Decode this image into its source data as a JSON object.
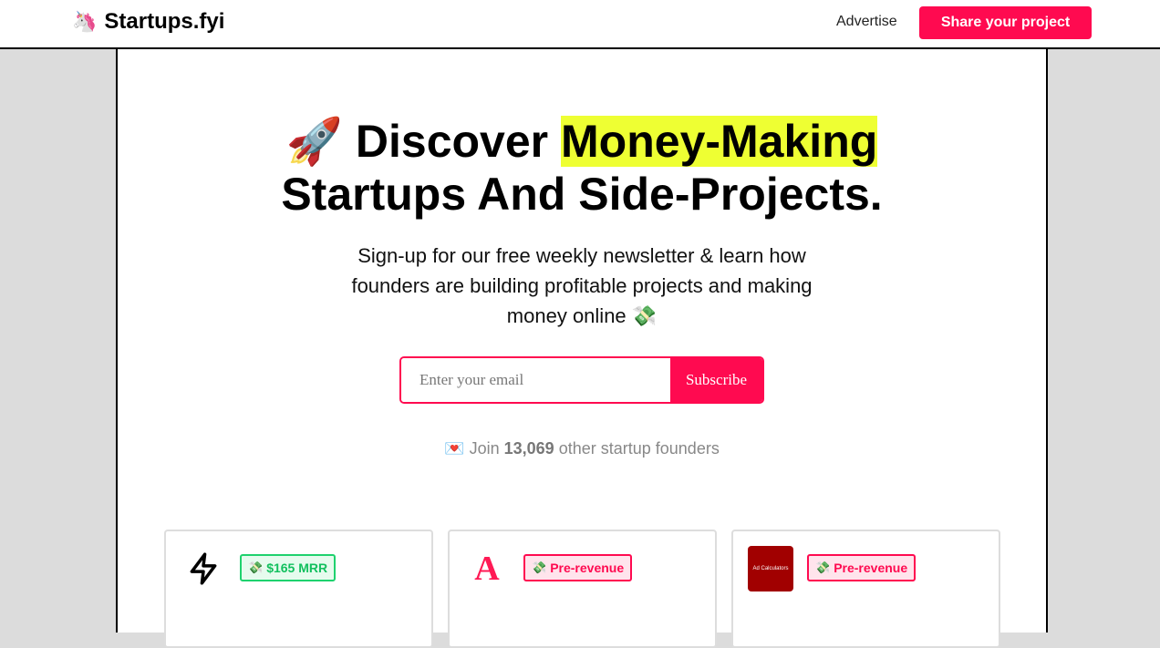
{
  "header": {
    "logo_emoji": "🦄",
    "logo_text": "Startups.fyi",
    "advertise_label": "Advertise",
    "share_button_label": "Share your project"
  },
  "hero": {
    "emoji": "🚀",
    "title_before": "Discover",
    "title_highlight": "Money-Making",
    "title_after": "Startups And Side-Projects.",
    "subtitle": "Sign-up for our free weekly newsletter & learn how founders are building profitable projects and making money online",
    "subtitle_emoji": "💸"
  },
  "subscribe": {
    "email_placeholder": "Enter your email",
    "email_value": "",
    "button_label": "Subscribe"
  },
  "join": {
    "emoji": "💌",
    "prefix": "Join",
    "count": "13,069",
    "suffix": "other startup founders"
  },
  "cards": [
    {
      "icon": "lightning-icon",
      "badge_emoji": "💸",
      "badge_label": "$165 MRR",
      "badge_type": "revenue"
    },
    {
      "icon": "letter-a-logo",
      "logo_text": "A",
      "badge_emoji": "💸",
      "badge_label": "Pre-revenue",
      "badge_type": "pre-revenue"
    },
    {
      "icon": "ad-calculators-logo",
      "logo_text": "Ad Calculators",
      "badge_emoji": "💸",
      "badge_label": "Pre-revenue",
      "badge_type": "pre-revenue"
    }
  ],
  "colors": {
    "brand": "#ff0a50",
    "highlight": "#eeff33",
    "revenue_green": "#1ed26e",
    "page_bg": "#dcdcdc"
  }
}
